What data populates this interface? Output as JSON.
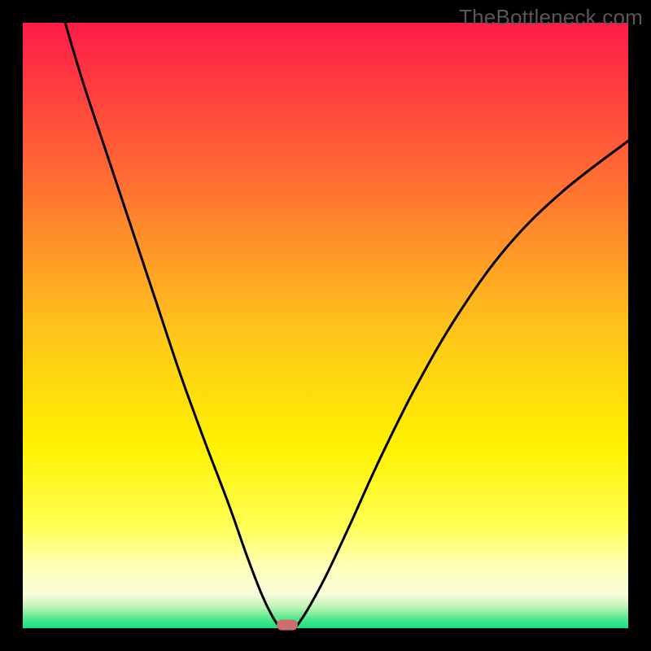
{
  "watermark": "TheBottleneck.com",
  "chart_data": {
    "type": "line",
    "title": "",
    "xlabel": "",
    "ylabel": "",
    "xlim": [
      0,
      1
    ],
    "ylim": [
      0,
      1
    ],
    "gradient_stops": [
      {
        "offset": 0.0,
        "color": "#ff1b49"
      },
      {
        "offset": 0.25,
        "color": "#ff6a33"
      },
      {
        "offset": 0.5,
        "color": "#ffc21c"
      },
      {
        "offset": 0.7,
        "color": "#fff200"
      },
      {
        "offset": 0.83,
        "color": "#ffff54"
      },
      {
        "offset": 0.9,
        "color": "#ffffbb"
      },
      {
        "offset": 0.945,
        "color": "#f6fddb"
      },
      {
        "offset": 0.965,
        "color": "#bff3b3"
      },
      {
        "offset": 0.985,
        "color": "#4de88d"
      },
      {
        "offset": 1.0,
        "color": "#18e082"
      }
    ],
    "series": [
      {
        "name": "left-branch",
        "x": [
          0.07,
          0.1,
          0.14,
          0.18,
          0.22,
          0.26,
          0.3,
          0.34,
          0.37,
          0.395,
          0.412,
          0.425
        ],
        "y": [
          1.0,
          0.9,
          0.78,
          0.66,
          0.54,
          0.42,
          0.31,
          0.205,
          0.12,
          0.055,
          0.02,
          0.0
        ]
      },
      {
        "name": "right-branch",
        "x": [
          0.45,
          0.47,
          0.5,
          0.54,
          0.59,
          0.65,
          0.72,
          0.8,
          0.89,
          1.0
        ],
        "y": [
          0.0,
          0.03,
          0.085,
          0.17,
          0.28,
          0.4,
          0.52,
          0.63,
          0.72,
          0.805
        ]
      }
    ],
    "marker": {
      "x": 0.437,
      "y": 0.0
    }
  }
}
